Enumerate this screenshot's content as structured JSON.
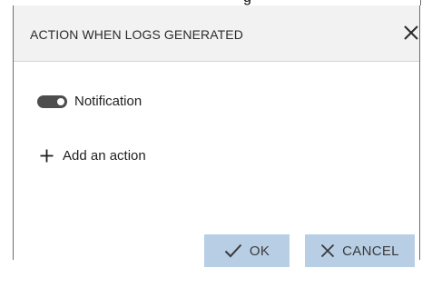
{
  "background_caption_fragment": "g",
  "dialog": {
    "title": "ACTION WHEN LOGS GENERATED",
    "close_icon": "close-icon"
  },
  "notification": {
    "label": "Notification",
    "enabled": true
  },
  "add_action": {
    "label": "Add an action",
    "icon": "plus-icon"
  },
  "buttons": {
    "ok_label": "OK",
    "ok_icon": "checkmark-icon",
    "cancel_label": "CANCEL",
    "cancel_icon": "x-icon",
    "color": "#b8cee4"
  },
  "colors": {
    "header_bg": "#f2f2f2",
    "toggle_on": "#4d4d4d"
  }
}
